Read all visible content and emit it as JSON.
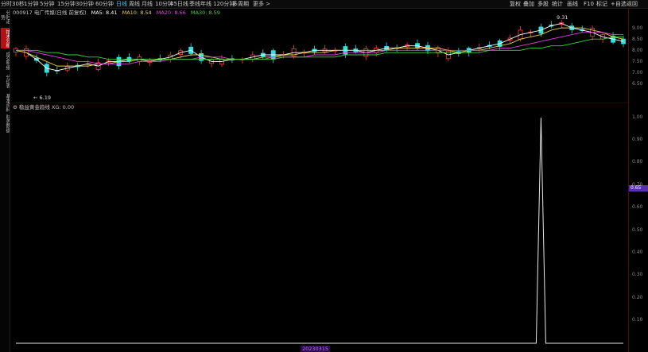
{
  "toolbar": {
    "periods": [
      "分时",
      "30秒",
      "1分钟",
      "5分钟",
      "15分钟",
      "30分钟",
      "60分钟",
      "日线",
      "周线",
      "月线",
      "10分钟",
      "45日线",
      "季线",
      "年线",
      "120分钟",
      "多周期",
      "更多 >"
    ],
    "active_period": "日线",
    "right_buttons": [
      "复权",
      "叠加",
      "多股",
      "统计",
      "画线",
      "F10",
      "标记",
      "+自选",
      "返回"
    ]
  },
  "side_tabs": [
    "分时走势",
    "技术分析",
    "成交明细",
    "分价表",
    "基本资料",
    "财务数据"
  ],
  "side_tab_selected": "技术分析",
  "main_chart": {
    "title": "000917 电广传媒(日线 前复权)",
    "ma_label": "MA5: 8.41",
    "ma10_label": "MA10: 8.54",
    "ma20_label": "MA20: 8.66",
    "ma30_label": "MA30: 8.59",
    "low_marker": "6.19",
    "high_marker": "9.31",
    "y_ticks": [
      "9.00",
      "8.50",
      "8.00",
      "7.50",
      "7.00",
      "6.50"
    ],
    "ylim": [
      6.1,
      9.5
    ],
    "colors": {
      "up": "#ff3b3b",
      "down": "#33e0e0",
      "ma5": "#ffffff",
      "ma10": "#e8d14a",
      "ma20": "#e040e0",
      "ma30": "#3dd13d"
    }
  },
  "indicator": {
    "title": "稳益黄金趋线 XG: 0.00",
    "current_value": "0.65",
    "y_ticks": [
      "1.00",
      "0.90",
      "0.80",
      "0.70",
      "0.60",
      "0.50",
      "0.40",
      "0.30",
      "0.20",
      "0.10"
    ],
    "bottom_label": "20230315"
  },
  "chart_data": [
    {
      "type": "line",
      "title": "",
      "series": [
        {
          "name": "MA5",
          "values": [
            8.0,
            7.9,
            7.6,
            7.2,
            7.1,
            7.2,
            7.3,
            7.4,
            7.3,
            7.5,
            7.5,
            7.6,
            7.6,
            7.5,
            7.6,
            7.7,
            7.9,
            8.0,
            7.7,
            7.5,
            7.5,
            7.6,
            7.6,
            7.7,
            7.8,
            7.8,
            7.8,
            7.9,
            7.9,
            8.0,
            8.0,
            8.0,
            8.0,
            8.0,
            7.9,
            8.0,
            8.1,
            8.1,
            8.2,
            8.2,
            8.1,
            8.0,
            7.8,
            7.9,
            8.0,
            8.1,
            8.2,
            8.3,
            8.5,
            8.7,
            8.8,
            8.9,
            9.1,
            9.2,
            9.0,
            8.9,
            8.8,
            8.6,
            8.5,
            8.4
          ]
        },
        {
          "name": "MA10",
          "values": [
            8.0,
            7.9,
            7.7,
            7.5,
            7.3,
            7.3,
            7.3,
            7.3,
            7.4,
            7.4,
            7.5,
            7.5,
            7.6,
            7.6,
            7.6,
            7.6,
            7.7,
            7.8,
            7.8,
            7.7,
            7.6,
            7.6,
            7.6,
            7.6,
            7.7,
            7.7,
            7.8,
            7.8,
            7.9,
            7.9,
            7.9,
            8.0,
            8.0,
            8.0,
            8.0,
            8.0,
            8.0,
            8.1,
            8.1,
            8.1,
            8.1,
            8.1,
            8.0,
            7.9,
            8.0,
            8.0,
            8.1,
            8.2,
            8.3,
            8.5,
            8.6,
            8.7,
            8.9,
            9.0,
            9.0,
            9.0,
            8.9,
            8.8,
            8.6,
            8.5
          ]
        },
        {
          "name": "MA20",
          "values": [
            8.0,
            8.0,
            7.9,
            7.8,
            7.7,
            7.6,
            7.5,
            7.5,
            7.4,
            7.4,
            7.4,
            7.4,
            7.5,
            7.5,
            7.5,
            7.6,
            7.6,
            7.6,
            7.7,
            7.7,
            7.7,
            7.6,
            7.6,
            7.6,
            7.6,
            7.7,
            7.7,
            7.7,
            7.7,
            7.8,
            7.8,
            7.8,
            7.9,
            7.9,
            7.9,
            7.9,
            8.0,
            8.0,
            8.0,
            8.0,
            8.0,
            8.0,
            8.0,
            8.0,
            8.0,
            8.0,
            8.0,
            8.1,
            8.1,
            8.2,
            8.3,
            8.4,
            8.5,
            8.6,
            8.7,
            8.8,
            8.8,
            8.8,
            8.7,
            8.7
          ]
        },
        {
          "name": "MA30",
          "values": [
            8.0,
            8.0,
            8.0,
            7.9,
            7.9,
            7.8,
            7.8,
            7.7,
            7.7,
            7.6,
            7.6,
            7.6,
            7.6,
            7.6,
            7.6,
            7.6,
            7.6,
            7.6,
            7.6,
            7.6,
            7.6,
            7.6,
            7.6,
            7.6,
            7.6,
            7.6,
            7.7,
            7.7,
            7.7,
            7.7,
            7.7,
            7.7,
            7.8,
            7.8,
            7.8,
            7.8,
            7.9,
            7.9,
            7.9,
            7.9,
            7.9,
            7.9,
            7.9,
            7.9,
            7.9,
            7.9,
            8.0,
            8.0,
            8.0,
            8.0,
            8.1,
            8.1,
            8.2,
            8.2,
            8.3,
            8.4,
            8.5,
            8.5,
            8.6,
            8.6
          ]
        }
      ],
      "ylim": [
        6.1,
        9.5
      ]
    },
    {
      "type": "line",
      "title": "",
      "series": [
        {
          "name": "XG",
          "values": [
            0,
            0,
            0,
            0,
            0,
            0,
            0,
            0,
            0,
            0,
            0,
            0,
            0,
            0,
            0,
            0,
            0,
            0,
            0,
            0,
            0,
            0,
            0,
            0,
            0,
            0,
            0,
            0,
            0,
            0,
            0,
            0,
            0,
            0,
            0,
            0,
            0,
            0,
            0,
            0,
            0,
            0,
            0,
            0,
            0,
            0,
            0,
            0,
            0,
            0,
            0,
            1,
            0,
            0,
            0,
            0,
            0,
            0,
            0,
            0
          ]
        }
      ],
      "ylim": [
        0,
        1.05
      ]
    }
  ]
}
